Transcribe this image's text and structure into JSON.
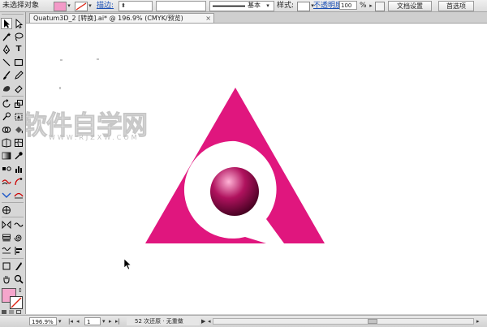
{
  "control_bar": {
    "selection_status": "未选择对象",
    "stroke_label": "描边:",
    "stroke_value": "",
    "brush_name": "基本",
    "style_label": "样式:",
    "opacity_label": "不透明度:",
    "opacity_value": "100",
    "opacity_unit": "%",
    "doc_setup_button": "文档设置",
    "preferences_button": "首选项",
    "fill_color": "#f39ac8"
  },
  "document_tab": {
    "title": "Quatum3D_2 [转换].ai* @ 196.9% (CMYK/预览)",
    "close": "×"
  },
  "tools": {
    "fill_swatch_color": "#f5a6cc"
  },
  "artwork": {
    "triangle_color": "#e0167e",
    "sphere_highlight": "#ffb3d6",
    "sphere_mid": "#b0125e",
    "sphere_dark": "#3e001d"
  },
  "watermark": {
    "text": "软件自学网",
    "subtext": "WWW.RJZXW.COM"
  },
  "status_bar": {
    "zoom": "196.9%",
    "artboard_number": "1",
    "status_text": "52 次还原 · 无重做"
  }
}
